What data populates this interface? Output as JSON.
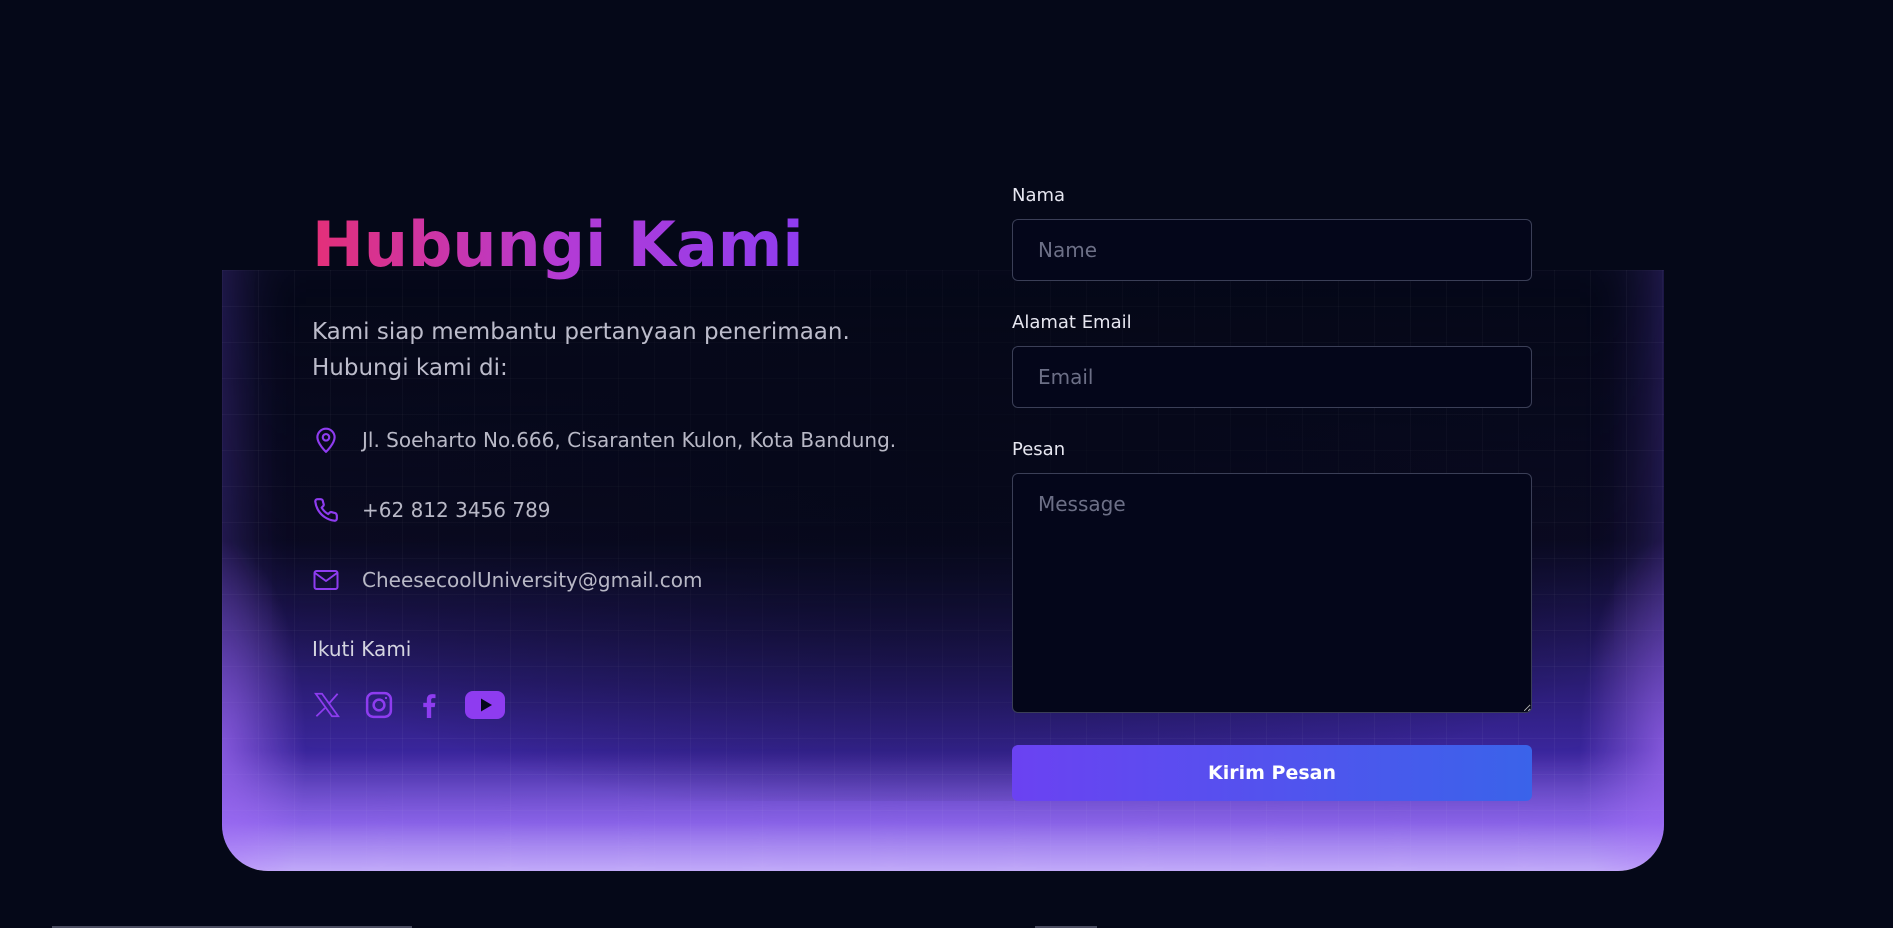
{
  "contact": {
    "title": "Hubungi Kami",
    "intro_line1": "Kami siap membantu pertanyaan penerimaan.",
    "intro_line2": "Hubungi kami di:",
    "address": "Jl. Soeharto No.666, Cisaranten Kulon, Kota Bandung.",
    "phone": "+62 812 3456 789",
    "email": "CheesecoolUniversity@gmail.com",
    "follow_label": "Ikuti Kami",
    "socials": [
      {
        "icon": "x-twitter-icon"
      },
      {
        "icon": "instagram-icon"
      },
      {
        "icon": "facebook-icon"
      },
      {
        "icon": "youtube-icon"
      }
    ],
    "accent_color": "#8e3cf0"
  },
  "form": {
    "name_label": "Nama",
    "name_placeholder": "Name",
    "email_label": "Alamat Email",
    "email_placeholder": "Email",
    "message_label": "Pesan",
    "message_placeholder": "Message",
    "submit_label": "Kirim Pesan"
  }
}
